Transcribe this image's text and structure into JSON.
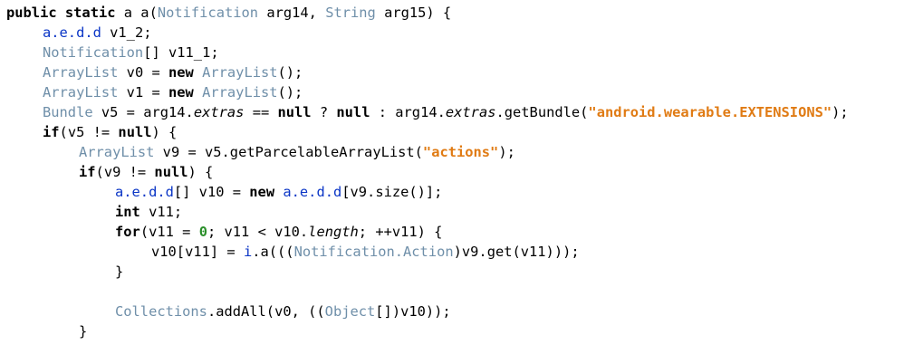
{
  "code": {
    "lines": [
      {
        "indent": 0,
        "tokens": [
          {
            "k": "kw",
            "t": "public"
          },
          {
            "k": "pl",
            "t": " "
          },
          {
            "k": "kw",
            "t": "static"
          },
          {
            "k": "pl",
            "t": " a a("
          },
          {
            "k": "ty",
            "t": "Notification"
          },
          {
            "k": "pl",
            "t": " arg14, "
          },
          {
            "k": "ty",
            "t": "String"
          },
          {
            "k": "pl",
            "t": " arg15) {"
          }
        ]
      },
      {
        "indent": 1,
        "tokens": [
          {
            "k": "pk",
            "t": "a.e.d.d"
          },
          {
            "k": "pl",
            "t": " v1_2;"
          }
        ]
      },
      {
        "indent": 1,
        "tokens": [
          {
            "k": "ty",
            "t": "Notification"
          },
          {
            "k": "pl",
            "t": "[] v11_1;"
          }
        ]
      },
      {
        "indent": 1,
        "tokens": [
          {
            "k": "ty",
            "t": "ArrayList"
          },
          {
            "k": "pl",
            "t": " v0 = "
          },
          {
            "k": "kw",
            "t": "new"
          },
          {
            "k": "pl",
            "t": " "
          },
          {
            "k": "ty",
            "t": "ArrayList"
          },
          {
            "k": "pl",
            "t": "();"
          }
        ]
      },
      {
        "indent": 1,
        "tokens": [
          {
            "k": "ty",
            "t": "ArrayList"
          },
          {
            "k": "pl",
            "t": " v1 = "
          },
          {
            "k": "kw",
            "t": "new"
          },
          {
            "k": "pl",
            "t": " "
          },
          {
            "k": "ty",
            "t": "ArrayList"
          },
          {
            "k": "pl",
            "t": "();"
          }
        ]
      },
      {
        "indent": 1,
        "tokens": [
          {
            "k": "ty",
            "t": "Bundle"
          },
          {
            "k": "pl",
            "t": " v5 = arg14."
          },
          {
            "k": "fld",
            "t": "extras"
          },
          {
            "k": "pl",
            "t": " == "
          },
          {
            "k": "kw",
            "t": "null"
          },
          {
            "k": "pl",
            "t": " ? "
          },
          {
            "k": "kw",
            "t": "null"
          },
          {
            "k": "pl",
            "t": " : arg14."
          },
          {
            "k": "fld",
            "t": "extras"
          },
          {
            "k": "pl",
            "t": ".getBundle("
          },
          {
            "k": "str",
            "t": "\"android.wearable.EXTENSIONS\""
          },
          {
            "k": "pl",
            "t": ");"
          }
        ]
      },
      {
        "indent": 1,
        "tokens": [
          {
            "k": "kw",
            "t": "if"
          },
          {
            "k": "pl",
            "t": "(v5 != "
          },
          {
            "k": "kw",
            "t": "null"
          },
          {
            "k": "pl",
            "t": ") {"
          }
        ]
      },
      {
        "indent": 2,
        "tokens": [
          {
            "k": "ty",
            "t": "ArrayList"
          },
          {
            "k": "pl",
            "t": " v9 = v5.getParcelableArrayList("
          },
          {
            "k": "str",
            "t": "\"actions\""
          },
          {
            "k": "pl",
            "t": ");"
          }
        ]
      },
      {
        "indent": 2,
        "tokens": [
          {
            "k": "kw",
            "t": "if"
          },
          {
            "k": "pl",
            "t": "(v9 != "
          },
          {
            "k": "kw",
            "t": "null"
          },
          {
            "k": "pl",
            "t": ") {"
          }
        ]
      },
      {
        "indent": 3,
        "tokens": [
          {
            "k": "pk",
            "t": "a.e.d.d"
          },
          {
            "k": "pl",
            "t": "[] v10 = "
          },
          {
            "k": "kw",
            "t": "new"
          },
          {
            "k": "pl",
            "t": " "
          },
          {
            "k": "pk",
            "t": "a.e.d.d"
          },
          {
            "k": "pl",
            "t": "[v9.size()];"
          }
        ]
      },
      {
        "indent": 3,
        "tokens": [
          {
            "k": "kw",
            "t": "int"
          },
          {
            "k": "pl",
            "t": " v11;"
          }
        ]
      },
      {
        "indent": 3,
        "tokens": [
          {
            "k": "kw",
            "t": "for"
          },
          {
            "k": "pl",
            "t": "(v11 = "
          },
          {
            "k": "num",
            "t": "0"
          },
          {
            "k": "pl",
            "t": "; v11 < v10."
          },
          {
            "k": "fld",
            "t": "length"
          },
          {
            "k": "pl",
            "t": "; ++v11) {"
          }
        ]
      },
      {
        "indent": 4,
        "tokens": [
          {
            "k": "pl",
            "t": "v10[v11] = "
          },
          {
            "k": "pk",
            "t": "i"
          },
          {
            "k": "pl",
            "t": ".a((("
          },
          {
            "k": "ty",
            "t": "Notification.Action"
          },
          {
            "k": "pl",
            "t": ")v9.get(v11)));"
          }
        ]
      },
      {
        "indent": 3,
        "tokens": [
          {
            "k": "pl",
            "t": "}"
          }
        ]
      },
      {
        "indent": 0,
        "tokens": []
      },
      {
        "indent": 3,
        "tokens": [
          {
            "k": "ty",
            "t": "Collections"
          },
          {
            "k": "pl",
            "t": ".addAll(v0, (("
          },
          {
            "k": "ty",
            "t": "Object"
          },
          {
            "k": "pl",
            "t": "[])v10));"
          }
        ]
      },
      {
        "indent": 2,
        "tokens": [
          {
            "k": "pl",
            "t": "}"
          }
        ]
      }
    ]
  },
  "colors": {
    "keyword": "#000000",
    "type": "#6f8fa9",
    "package": "#0b36c6",
    "string": "#e07b14",
    "number": "#2a8f2a",
    "background": "#ffffff"
  }
}
